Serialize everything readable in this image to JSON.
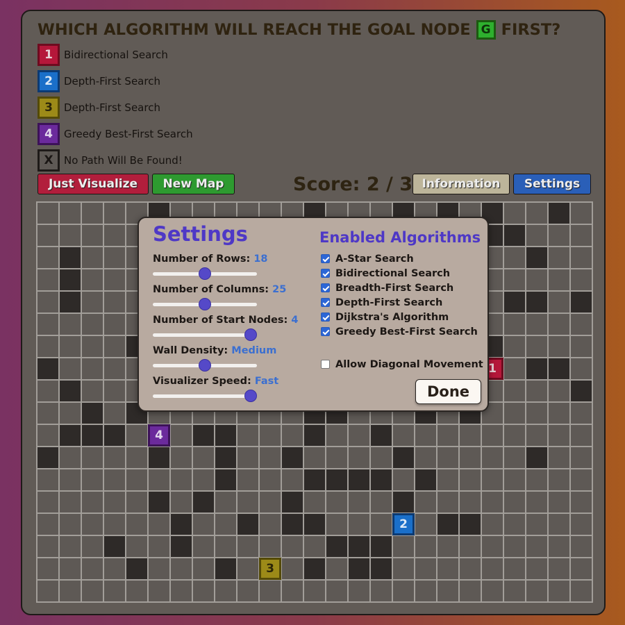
{
  "header": {
    "question_before": "WHICH ALGORITHM WILL REACH THE GOAL NODE",
    "goal_symbol": "G",
    "question_after": "FIRST?"
  },
  "legend": [
    {
      "symbol": "1",
      "label": "Bidirectional Search",
      "fill": "#b5173a",
      "border": "#6e0b1f",
      "text": "#e8d0d5"
    },
    {
      "symbol": "2",
      "label": "Depth-First Search",
      "fill": "#1a6fc9",
      "border": "#0c3a72",
      "text": "#dce9f7"
    },
    {
      "symbol": "3",
      "label": "Depth-First Search",
      "fill": "#9c8a18",
      "border": "#544a08",
      "text": "#2c2608"
    },
    {
      "symbol": "4",
      "label": "Greedy Best-First Search",
      "fill": "#6b2a9c",
      "border": "#3c1258",
      "text": "#e4d8ee"
    },
    {
      "symbol": "X",
      "label": "No Path Will Be Found!",
      "fill": "#5e5955",
      "border": "#1e1a18",
      "text": "#1a1614"
    }
  ],
  "toolbar": {
    "just_visualize": "Just Visualize",
    "new_map": "New Map",
    "score": "Score: 2 / 3",
    "information": "Information",
    "settings": "Settings"
  },
  "colors": {
    "just_visualize": "#b21e3c",
    "new_map": "#2e9a30",
    "information": "#bdb59a",
    "settings": "#2a5fb8"
  },
  "grid": {
    "rows": 18,
    "columns": 25,
    "walls": [
      [
        0,
        5
      ],
      [
        0,
        12
      ],
      [
        0,
        16
      ],
      [
        0,
        18
      ],
      [
        0,
        20
      ],
      [
        0,
        23
      ],
      [
        1,
        20
      ],
      [
        1,
        21
      ],
      [
        2,
        1
      ],
      [
        2,
        22
      ],
      [
        3,
        1
      ],
      [
        4,
        1
      ],
      [
        4,
        21
      ],
      [
        4,
        22
      ],
      [
        4,
        24
      ],
      [
        6,
        4
      ],
      [
        6,
        20
      ],
      [
        7,
        0
      ],
      [
        7,
        22
      ],
      [
        7,
        23
      ],
      [
        8,
        1
      ],
      [
        8,
        24
      ],
      [
        9,
        2
      ],
      [
        9,
        4
      ],
      [
        9,
        12
      ],
      [
        9,
        13
      ],
      [
        9,
        17
      ],
      [
        9,
        19
      ],
      [
        10,
        1
      ],
      [
        10,
        2
      ],
      [
        10,
        3
      ],
      [
        10,
        7
      ],
      [
        10,
        8
      ],
      [
        10,
        12
      ],
      [
        10,
        15
      ],
      [
        11,
        0
      ],
      [
        11,
        5
      ],
      [
        11,
        8
      ],
      [
        11,
        11
      ],
      [
        11,
        16
      ],
      [
        11,
        22
      ],
      [
        12,
        8
      ],
      [
        12,
        12
      ],
      [
        12,
        13
      ],
      [
        12,
        14
      ],
      [
        12,
        15
      ],
      [
        12,
        17
      ],
      [
        13,
        5
      ],
      [
        13,
        7
      ],
      [
        13,
        11
      ],
      [
        13,
        16
      ],
      [
        14,
        6
      ],
      [
        14,
        9
      ],
      [
        14,
        11
      ],
      [
        14,
        12
      ],
      [
        14,
        18
      ],
      [
        14,
        19
      ],
      [
        15,
        3
      ],
      [
        15,
        6
      ],
      [
        15,
        13
      ],
      [
        15,
        14
      ],
      [
        15,
        15
      ],
      [
        16,
        4
      ],
      [
        16,
        8
      ],
      [
        16,
        12
      ],
      [
        16,
        14
      ],
      [
        16,
        15
      ]
    ],
    "starts": [
      {
        "row": 7,
        "col": 20,
        "symbol": "1"
      },
      {
        "row": 14,
        "col": 16,
        "symbol": "2"
      },
      {
        "row": 16,
        "col": 10,
        "symbol": "3"
      },
      {
        "row": 10,
        "col": 5,
        "symbol": "4"
      }
    ]
  },
  "settings_modal": {
    "title": "Settings",
    "fields": [
      {
        "label": "Number of Rows:",
        "value": "18",
        "level": 0.5
      },
      {
        "label": "Number of Columns:",
        "value": "25",
        "level": 0.5
      },
      {
        "label": "Number of Start Nodes:",
        "value": "4",
        "level": 0.94
      },
      {
        "label": "Wall Density:",
        "value": "Medium",
        "level": 0.5
      },
      {
        "label": "Visualizer Speed:",
        "value": "Fast",
        "level": 0.94
      }
    ],
    "algorithms_title": "Enabled Algorithms",
    "algorithms": [
      {
        "label": "A-Star Search",
        "checked": true
      },
      {
        "label": "Bidirectional Search",
        "checked": true
      },
      {
        "label": "Breadth-First Search",
        "checked": true
      },
      {
        "label": "Depth-First Search",
        "checked": true
      },
      {
        "label": "Dijkstra's Algorithm",
        "checked": true
      },
      {
        "label": "Greedy Best-First Search",
        "checked": true
      }
    ],
    "diagonal": {
      "label": "Allow Diagonal Movement",
      "checked": false
    },
    "done": "Done"
  }
}
